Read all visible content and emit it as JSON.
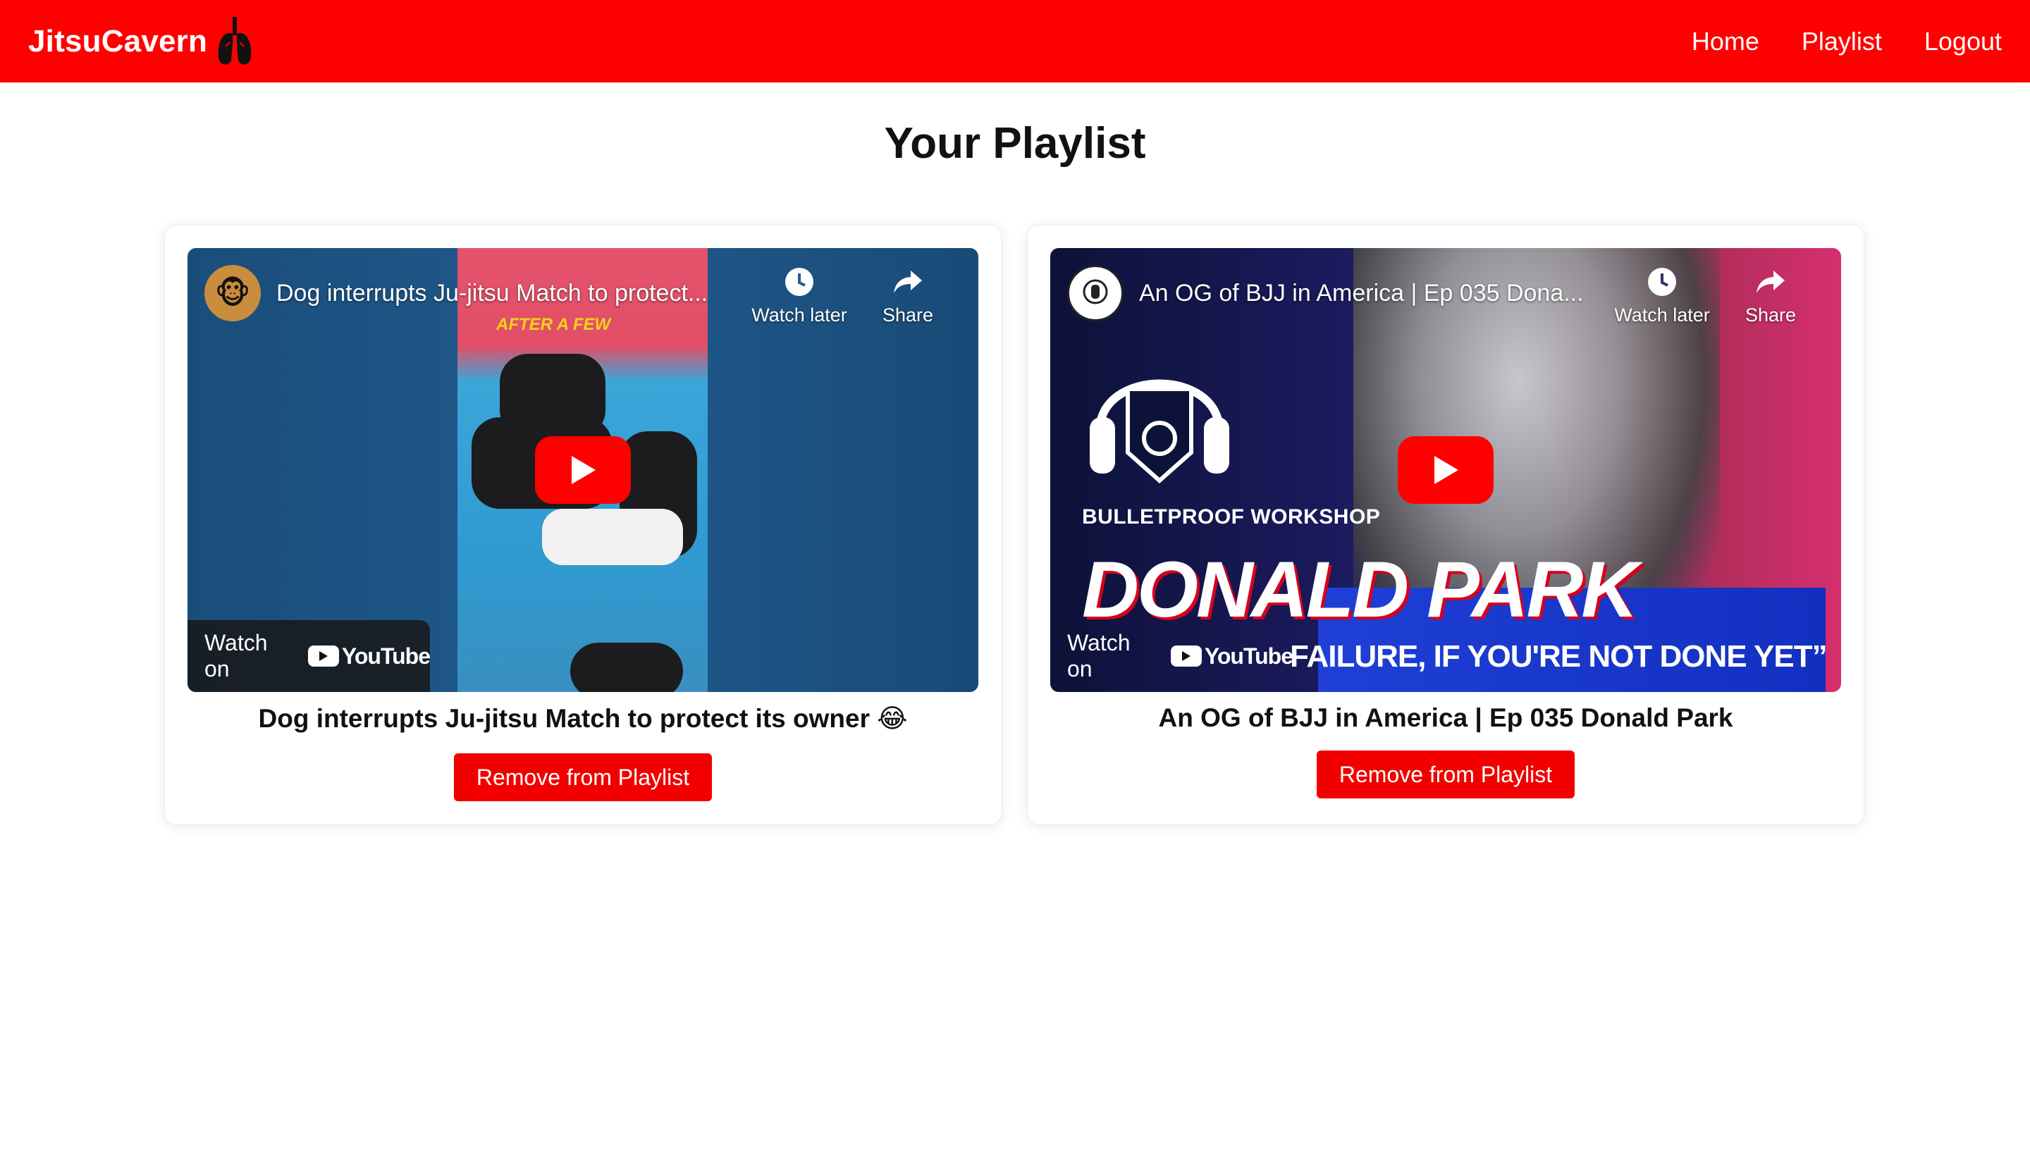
{
  "nav": {
    "brand": "JitsuCavern",
    "links": [
      "Home",
      "Playlist",
      "Logout"
    ]
  },
  "page": {
    "title": "Your Playlist"
  },
  "videos": [
    {
      "embed_title": "Dog interrupts Ju-jitsu Match to protect...",
      "overlay_text": "AFTER A FEW",
      "watch_later": "Watch later",
      "share": "Share",
      "watch_on": "Watch on",
      "youtube": "YouTube",
      "title": "Dog interrupts Ju-jitsu Match to protect its owner 😂",
      "button": "Remove from Playlist"
    },
    {
      "embed_title": "An OG of BJJ in America | Ep 035 Dona...",
      "thumb_workshop": "BULLETPROOF WORKSHOP",
      "thumb_name": "DONALD PARK",
      "thumb_quote": "FAILURE, IF YOU'RE NOT DONE YET”",
      "watch_later": "Watch later",
      "share": "Share",
      "watch_on": "Watch on",
      "youtube": "YouTube",
      "title": "An OG of BJJ in America | Ep 035 Donald Park",
      "button": "Remove from Playlist"
    }
  ],
  "colors": {
    "brand": "#ff0000",
    "button": "#f20000"
  }
}
